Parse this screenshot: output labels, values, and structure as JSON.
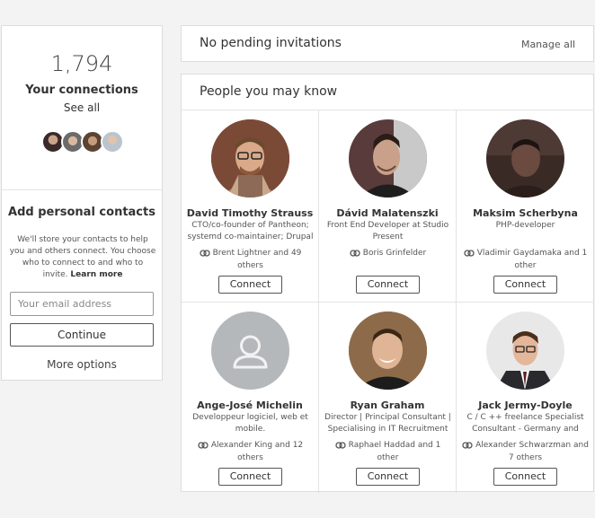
{
  "connections": {
    "count": "1,794",
    "label": "Your connections",
    "see_all": "See all",
    "avatars": [
      "avatar-1",
      "avatar-2",
      "avatar-3",
      "avatar-4"
    ]
  },
  "add_contacts": {
    "title": "Add personal contacts",
    "description": "We'll store your contacts to help you and others connect. You choose who to connect to and who to invite.",
    "learn_more": "Learn more",
    "email_placeholder": "Your email address",
    "continue_label": "Continue",
    "more_options": "More options"
  },
  "invitations": {
    "title": "No pending invitations",
    "manage_all": "Manage all"
  },
  "pymk": {
    "title": "People you may know",
    "connect_label": "Connect",
    "people": [
      {
        "name": "David Timothy Strauss",
        "title": "CTO/co-founder of Pantheon; systemd co-maintainer; Drupal",
        "shared": "Brent Lightner and 49 others"
      },
      {
        "name": "Dávid Malatenszki",
        "title": "Front End Developer at Studio Present",
        "shared": "Boris Grinfelder"
      },
      {
        "name": "Maksim Scherbyna",
        "title": "PHP-developer",
        "shared": "Vladimir Gaydamaka and 1 other"
      },
      {
        "name": "Ange-José Michelin",
        "title": "Developpeur logiciel, web et mobile.",
        "shared": "Alexander King and 12 others"
      },
      {
        "name": "Ryan Graham",
        "title": "Director | Principal Consultant | Specialising in IT Recruitment",
        "shared": "Raphael Haddad and 1 other"
      },
      {
        "name": "Jack Jermy-Doyle",
        "title": "C / C ++ freelance Specialist Consultant - Germany and",
        "shared": "Alexander Schwarzman and 7 others"
      }
    ]
  },
  "colors": {
    "page_bg": "#f3f3f3",
    "card_bg": "#ffffff",
    "border": "#dcdcdc",
    "text": "#333333",
    "placeholder_avatar": "#b5b8ba"
  }
}
